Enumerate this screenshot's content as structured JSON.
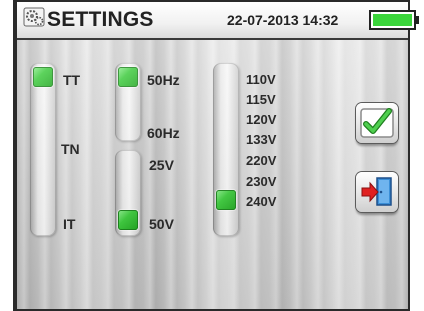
{
  "header": {
    "title": "SETTINGS",
    "datetime": "22-07-2013 14:32",
    "icon": "settings-icon",
    "battery": {
      "icon": "battery-icon",
      "charge_level": 1.0,
      "color": "#3ad43a"
    }
  },
  "settings": {
    "system": {
      "options": [
        "TT",
        "TN",
        "IT"
      ],
      "selected": "TT"
    },
    "frequency": {
      "options": [
        "50Hz",
        "60Hz"
      ],
      "selected": "50Hz"
    },
    "contact_voltage": {
      "options": [
        "25V",
        "50V"
      ],
      "selected": "50V"
    },
    "nominal_voltage": {
      "options": [
        "110V",
        "115V",
        "120V",
        "133V",
        "220V",
        "230V",
        "240V"
      ],
      "selected": "230V"
    }
  },
  "buttons": {
    "confirm": {
      "icon": "checkmark-icon",
      "color": "#2fa52f"
    },
    "exit": {
      "icon": "exit-door-icon",
      "color": "#d42020"
    }
  },
  "colors": {
    "knob": "#2fc82f",
    "frame": "#2a2a2a"
  }
}
